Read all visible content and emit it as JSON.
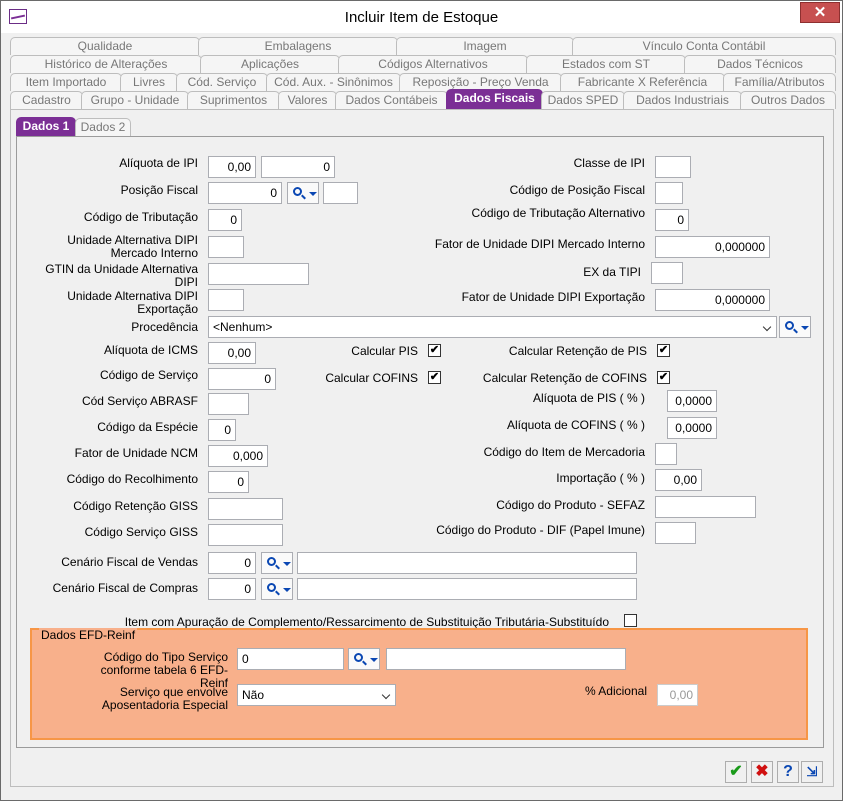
{
  "window": {
    "title": "Incluir Item de Estoque",
    "close": "✕"
  },
  "tabs": {
    "row1": [
      "Qualidade",
      "Embalagens",
      "Imagem",
      "Vínculo Conta Contábil"
    ],
    "row2": [
      "Histórico de Alterações",
      "Aplicações",
      "Códigos Alternativos",
      "Estados com ST",
      "Dados Técnicos"
    ],
    "row3": [
      "Item Importado",
      "Livres",
      "Cód. Serviço",
      "Cód. Aux. - Sinônimos",
      "Reposição - Preço Venda",
      "Fabricante X Referência",
      "Família/Atributos"
    ],
    "row4": [
      "Cadastro",
      "Grupo - Unidade",
      "Suprimentos",
      "Valores",
      "Dados Contábeis",
      "Dados Fiscais",
      "Dados SPED",
      "Dados Industriais",
      "Outros Dados"
    ]
  },
  "subtabs": [
    "Dados 1",
    "Dados 2"
  ],
  "left": {
    "aliquota_ipi": {
      "label": "Alíquota de IPI",
      "v1": "0,00",
      "v2": "0"
    },
    "posicao_fiscal": {
      "label": "Posição Fiscal",
      "v1": "0",
      "v2": ""
    },
    "codigo_tributacao": {
      "label": "Código de Tributação",
      "value": "0"
    },
    "unid_alt_dipi_mi": {
      "label": "Unidade Alternativa DIPI Mercado Interno",
      "value": ""
    },
    "gtin": {
      "label": "GTIN da Unidade Alternativa DIPI",
      "value": ""
    },
    "unid_alt_dipi_exp": {
      "label": "Unidade Alternativa DIPI Exportação",
      "value": ""
    },
    "procedencia": {
      "label": "Procedência",
      "value": "<Nenhum>"
    },
    "aliquota_icms": {
      "label": "Alíquota de ICMS",
      "value": "0,00"
    },
    "codigo_servico": {
      "label": "Código de Serviço",
      "value": "0"
    },
    "cod_servico_abrasf": {
      "label": "Cód Serviço ABRASF",
      "value": ""
    },
    "codigo_especie": {
      "label": "Código da Espécie",
      "value": "0"
    },
    "fator_ncm": {
      "label": "Fator de Unidade NCM",
      "value": "0,000"
    },
    "codigo_recolhimento": {
      "label": "Código do Recolhimento",
      "value": "0"
    },
    "codigo_retencao_giss": {
      "label": "Código Retenção GISS",
      "value": ""
    },
    "codigo_servico_giss": {
      "label": "Código Serviço GISS",
      "value": ""
    },
    "cenario_vendas": {
      "label": "Cenário Fiscal de Vendas",
      "value": "0",
      "desc": ""
    },
    "cenario_compras": {
      "label": "Cenário Fiscal de Compras",
      "value": "0",
      "desc": ""
    }
  },
  "middle": {
    "calcular_pis": {
      "label": "Calcular PIS",
      "checked": "✔"
    },
    "calcular_cofins": {
      "label": "Calcular COFINS",
      "checked": "✔"
    }
  },
  "right": {
    "classe_ipi": {
      "label": "Classe de IPI",
      "value": ""
    },
    "codigo_posicao_fiscal": {
      "label": "Código de Posição Fiscal",
      "value": ""
    },
    "codigo_tributacao_alt": {
      "label": "Código de Tributação Alternativo",
      "value": "0"
    },
    "fator_dipi_mi": {
      "label": "Fator de Unidade DIPI Mercado Interno",
      "value": "0,000000"
    },
    "ex_tipi": {
      "label": "EX da TIPI",
      "value": ""
    },
    "fator_dipi_exp": {
      "label": "Fator de Unidade DIPI Exportação",
      "value": "0,000000"
    },
    "calc_ret_pis": {
      "label": "Calcular Retenção de PIS",
      "checked": "✔"
    },
    "calc_ret_cofins": {
      "label": "Calcular Retenção de COFINS",
      "checked": "✔"
    },
    "aliquota_pis": {
      "label": "Alíquota de PIS  ( % )",
      "value": "0,0000"
    },
    "aliquota_cofins": {
      "label": "Alíquota de COFINS  ( % )",
      "value": "0,0000"
    },
    "codigo_item_mercadoria": {
      "label": "Código do Item de Mercadoria",
      "value": ""
    },
    "importacao": {
      "label": "Importação  ( % )",
      "value": "0,00"
    },
    "codigo_produto_sefaz": {
      "label": "Código do Produto - SEFAZ",
      "value": ""
    },
    "codigo_produto_dif": {
      "label": "Código do Produto - DIF (Papel Imune)",
      "value": ""
    }
  },
  "complemento": {
    "label": "Item com Apuração de Complemento/Ressarcimento de Substituição Tributária-Substituído",
    "checked": ""
  },
  "efd": {
    "legend": "Dados EFD-Reinf",
    "tipo_servico": {
      "label": "Código do Tipo Serviço conforme tabela 6 EFD-Reinf",
      "value": "0",
      "desc": ""
    },
    "aposentadoria": {
      "label": "Serviço que envolve Aposentadoria Especial",
      "value": "Não"
    },
    "adicional": {
      "label": "% Adicional",
      "value": "0,00"
    }
  },
  "toolbar": {
    "ok": "✔",
    "cancel": "✖",
    "help": "?",
    "exit": "⇲"
  },
  "colors": {
    "accent": "#7b2f95",
    "efd_bg": "#f8b08b",
    "efd_border": "#f79646"
  }
}
